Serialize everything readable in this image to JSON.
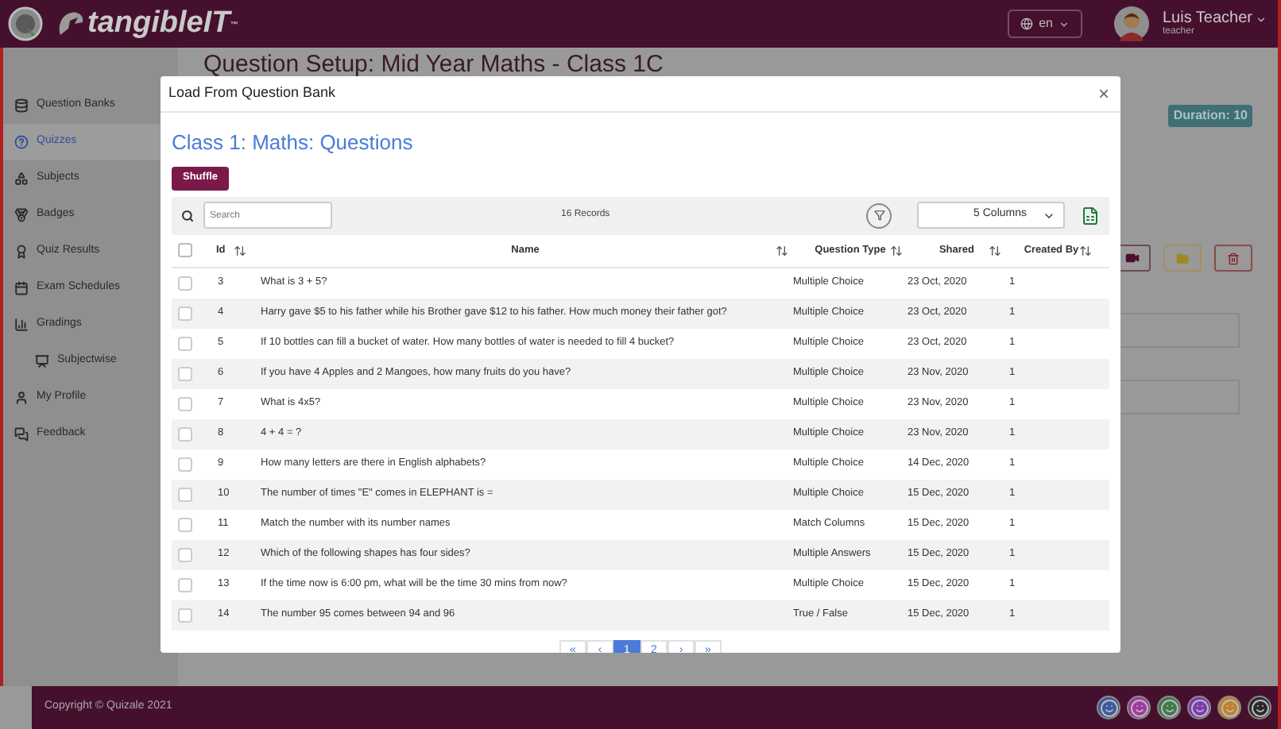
{
  "header": {
    "brand": "tangibleIT",
    "brand_suffix": "™",
    "language": "en",
    "user_name": "Luis Teacher",
    "user_role": "teacher"
  },
  "sidebar": {
    "items": [
      {
        "label": "Question Banks",
        "selected": false
      },
      {
        "label": "Quizzes",
        "selected": true
      },
      {
        "label": "Subjects",
        "selected": false
      },
      {
        "label": "Badges",
        "selected": false
      },
      {
        "label": "Quiz Results",
        "selected": false
      },
      {
        "label": "Exam Schedules",
        "selected": false
      },
      {
        "label": "Gradings",
        "selected": false,
        "children": [
          {
            "label": "Subjectwise",
            "selected": false
          }
        ]
      },
      {
        "label": "My Profile",
        "selected": false
      },
      {
        "label": "Feedback",
        "selected": false
      }
    ]
  },
  "page": {
    "title": "Question Setup: Mid Year Maths - Class 1C",
    "duration": "Duration: 10"
  },
  "dialog": {
    "title": "Load From Question Bank",
    "close": "×",
    "heading": "Class 1: Maths: Questions",
    "shuffle": "Shuffle",
    "search": {
      "placeholder": "Search"
    },
    "records": "16 Records",
    "columns_select": "5 Columns",
    "table": {
      "select_all_checked": false,
      "columns": [
        "Id",
        "Name",
        "Question Type",
        "Shared",
        "Created By"
      ],
      "rows": [
        {
          "checked": false,
          "cells": [
            "3",
            "What is 3 + 5?",
            "Multiple Choice",
            "23 Oct, 2020",
            "1"
          ]
        },
        {
          "checked": false,
          "cells": [
            "4",
            "Harry gave $5 to his father while his Brother gave $12 to his father. How much money their father got?",
            "Multiple Choice",
            "23 Oct, 2020",
            "1"
          ]
        },
        {
          "checked": false,
          "cells": [
            "5",
            "If 10 bottles can fill a bucket of water. How many bottles of water is needed to fill 4 bucket?",
            "Multiple Choice",
            "23 Oct, 2020",
            "1"
          ]
        },
        {
          "checked": false,
          "cells": [
            "6",
            "If you have 4 Apples and 2 Mangoes, how many fruits do you have?",
            "Multiple Choice",
            "23 Nov, 2020",
            "1"
          ]
        },
        {
          "checked": false,
          "cells": [
            "7",
            "What is 4x5?",
            "Multiple Choice",
            "23 Nov, 2020",
            "1"
          ]
        },
        {
          "checked": false,
          "cells": [
            "8",
            "4 + 4 = ?",
            "Multiple Choice",
            "23 Nov, 2020",
            "1"
          ]
        },
        {
          "checked": false,
          "cells": [
            "9",
            "How many letters are there in English alphabets?",
            "Multiple Choice",
            "14 Dec, 2020",
            "1"
          ]
        },
        {
          "checked": false,
          "cells": [
            "10",
            "The number of times \"E\" comes in ELEPHANT is =",
            "Multiple Choice",
            "15 Dec, 2020",
            "1"
          ]
        },
        {
          "checked": false,
          "cells": [
            "11",
            "Match the number with its number names",
            "Match Columns",
            "15 Dec, 2020",
            "1"
          ]
        },
        {
          "checked": false,
          "cells": [
            "12",
            "Which of the following shapes has four sides?",
            "Multiple Answers",
            "15 Dec, 2020",
            "1"
          ]
        },
        {
          "checked": false,
          "cells": [
            "13",
            "If the time now is 6:00 pm, what will be the time 30 mins from now?",
            "Multiple Choice",
            "15 Dec, 2020",
            "1"
          ]
        },
        {
          "checked": false,
          "cells": [
            "14",
            "The number 95 comes between 94 and 96",
            "True / False",
            "15 Dec, 2020",
            "1"
          ]
        }
      ]
    },
    "pagination": [
      {
        "label": "«",
        "selected": false
      },
      {
        "label": "‹",
        "selected": false
      },
      {
        "label": "1",
        "selected": true
      },
      {
        "label": "2",
        "selected": false
      },
      {
        "label": "›",
        "selected": false
      },
      {
        "label": "»",
        "selected": false
      }
    ]
  },
  "footer": {
    "copyright": "Copyright © Quizale 2021",
    "feedback_faces": [
      {
        "color": "#3d5a9e"
      },
      {
        "color": "#a03aa0"
      },
      {
        "color": "#3e7a4a"
      },
      {
        "color": "#7a3ab0"
      },
      {
        "color": "#c0802a"
      },
      {
        "color": "#2a2a2a"
      }
    ]
  }
}
